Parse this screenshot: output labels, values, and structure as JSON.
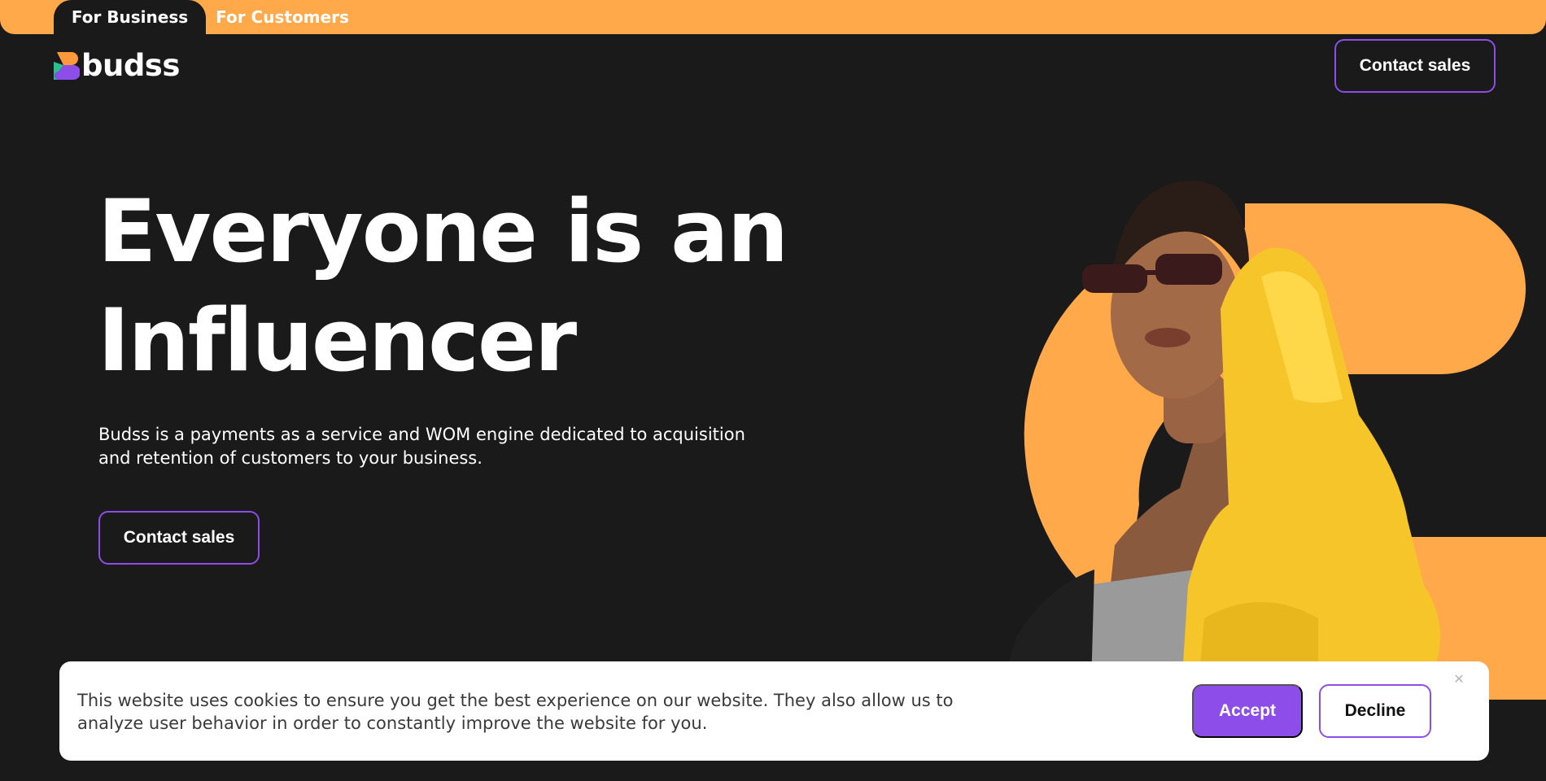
{
  "topbar": {
    "tabs": [
      {
        "label": "For Business",
        "active": true
      },
      {
        "label": "For Customers",
        "active": false
      }
    ]
  },
  "header": {
    "logo_text": "budss",
    "contact_label": "Contact sales"
  },
  "hero": {
    "title_line1": "Everyone is an",
    "title_line2": "Influencer",
    "description": "Budss is a payments as a service and WOM engine dedicated to acquisition and retention of customers to your business.",
    "contact_label": "Contact sales",
    "image_icon": "woman-yellow-jacket-image"
  },
  "cookie_banner": {
    "text": "This website uses cookies to ensure you get the best experience on our website. They also allow us to analyze user behavior in order to constantly improve the website for you.",
    "accept_label": "Accept",
    "decline_label": "Decline",
    "close_icon": "close-icon"
  },
  "colors": {
    "background": "#1a1a1a",
    "brand_orange": "#ffa94a",
    "accent_purple": "#8d4de8",
    "jacket_yellow": "#f6c52a"
  }
}
